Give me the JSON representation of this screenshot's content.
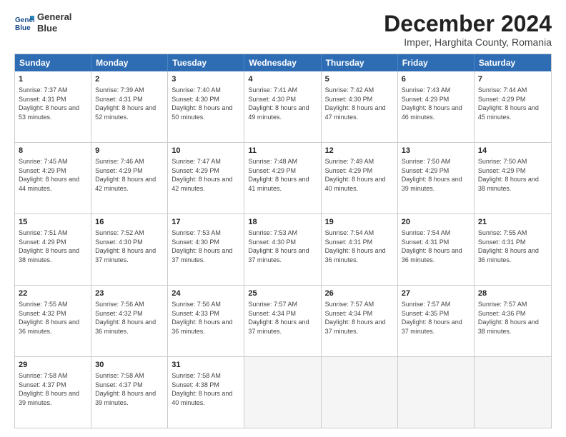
{
  "header": {
    "logo_line1": "General",
    "logo_line2": "Blue",
    "title": "December 2024",
    "subtitle": "Imper, Harghita County, Romania"
  },
  "days": [
    "Sunday",
    "Monday",
    "Tuesday",
    "Wednesday",
    "Thursday",
    "Friday",
    "Saturday"
  ],
  "weeks": [
    [
      {
        "day": "1",
        "sunrise": "Sunrise: 7:37 AM",
        "sunset": "Sunset: 4:31 PM",
        "daylight": "Daylight: 8 hours and 53 minutes."
      },
      {
        "day": "2",
        "sunrise": "Sunrise: 7:39 AM",
        "sunset": "Sunset: 4:31 PM",
        "daylight": "Daylight: 8 hours and 52 minutes."
      },
      {
        "day": "3",
        "sunrise": "Sunrise: 7:40 AM",
        "sunset": "Sunset: 4:30 PM",
        "daylight": "Daylight: 8 hours and 50 minutes."
      },
      {
        "day": "4",
        "sunrise": "Sunrise: 7:41 AM",
        "sunset": "Sunset: 4:30 PM",
        "daylight": "Daylight: 8 hours and 49 minutes."
      },
      {
        "day": "5",
        "sunrise": "Sunrise: 7:42 AM",
        "sunset": "Sunset: 4:30 PM",
        "daylight": "Daylight: 8 hours and 47 minutes."
      },
      {
        "day": "6",
        "sunrise": "Sunrise: 7:43 AM",
        "sunset": "Sunset: 4:29 PM",
        "daylight": "Daylight: 8 hours and 46 minutes."
      },
      {
        "day": "7",
        "sunrise": "Sunrise: 7:44 AM",
        "sunset": "Sunset: 4:29 PM",
        "daylight": "Daylight: 8 hours and 45 minutes."
      }
    ],
    [
      {
        "day": "8",
        "sunrise": "Sunrise: 7:45 AM",
        "sunset": "Sunset: 4:29 PM",
        "daylight": "Daylight: 8 hours and 44 minutes."
      },
      {
        "day": "9",
        "sunrise": "Sunrise: 7:46 AM",
        "sunset": "Sunset: 4:29 PM",
        "daylight": "Daylight: 8 hours and 42 minutes."
      },
      {
        "day": "10",
        "sunrise": "Sunrise: 7:47 AM",
        "sunset": "Sunset: 4:29 PM",
        "daylight": "Daylight: 8 hours and 42 minutes."
      },
      {
        "day": "11",
        "sunrise": "Sunrise: 7:48 AM",
        "sunset": "Sunset: 4:29 PM",
        "daylight": "Daylight: 8 hours and 41 minutes."
      },
      {
        "day": "12",
        "sunrise": "Sunrise: 7:49 AM",
        "sunset": "Sunset: 4:29 PM",
        "daylight": "Daylight: 8 hours and 40 minutes."
      },
      {
        "day": "13",
        "sunrise": "Sunrise: 7:50 AM",
        "sunset": "Sunset: 4:29 PM",
        "daylight": "Daylight: 8 hours and 39 minutes."
      },
      {
        "day": "14",
        "sunrise": "Sunrise: 7:50 AM",
        "sunset": "Sunset: 4:29 PM",
        "daylight": "Daylight: 8 hours and 38 minutes."
      }
    ],
    [
      {
        "day": "15",
        "sunrise": "Sunrise: 7:51 AM",
        "sunset": "Sunset: 4:29 PM",
        "daylight": "Daylight: 8 hours and 38 minutes."
      },
      {
        "day": "16",
        "sunrise": "Sunrise: 7:52 AM",
        "sunset": "Sunset: 4:30 PM",
        "daylight": "Daylight: 8 hours and 37 minutes."
      },
      {
        "day": "17",
        "sunrise": "Sunrise: 7:53 AM",
        "sunset": "Sunset: 4:30 PM",
        "daylight": "Daylight: 8 hours and 37 minutes."
      },
      {
        "day": "18",
        "sunrise": "Sunrise: 7:53 AM",
        "sunset": "Sunset: 4:30 PM",
        "daylight": "Daylight: 8 hours and 37 minutes."
      },
      {
        "day": "19",
        "sunrise": "Sunrise: 7:54 AM",
        "sunset": "Sunset: 4:31 PM",
        "daylight": "Daylight: 8 hours and 36 minutes."
      },
      {
        "day": "20",
        "sunrise": "Sunrise: 7:54 AM",
        "sunset": "Sunset: 4:31 PM",
        "daylight": "Daylight: 8 hours and 36 minutes."
      },
      {
        "day": "21",
        "sunrise": "Sunrise: 7:55 AM",
        "sunset": "Sunset: 4:31 PM",
        "daylight": "Daylight: 8 hours and 36 minutes."
      }
    ],
    [
      {
        "day": "22",
        "sunrise": "Sunrise: 7:55 AM",
        "sunset": "Sunset: 4:32 PM",
        "daylight": "Daylight: 8 hours and 36 minutes."
      },
      {
        "day": "23",
        "sunrise": "Sunrise: 7:56 AM",
        "sunset": "Sunset: 4:32 PM",
        "daylight": "Daylight: 8 hours and 36 minutes."
      },
      {
        "day": "24",
        "sunrise": "Sunrise: 7:56 AM",
        "sunset": "Sunset: 4:33 PM",
        "daylight": "Daylight: 8 hours and 36 minutes."
      },
      {
        "day": "25",
        "sunrise": "Sunrise: 7:57 AM",
        "sunset": "Sunset: 4:34 PM",
        "daylight": "Daylight: 8 hours and 37 minutes."
      },
      {
        "day": "26",
        "sunrise": "Sunrise: 7:57 AM",
        "sunset": "Sunset: 4:34 PM",
        "daylight": "Daylight: 8 hours and 37 minutes."
      },
      {
        "day": "27",
        "sunrise": "Sunrise: 7:57 AM",
        "sunset": "Sunset: 4:35 PM",
        "daylight": "Daylight: 8 hours and 37 minutes."
      },
      {
        "day": "28",
        "sunrise": "Sunrise: 7:57 AM",
        "sunset": "Sunset: 4:36 PM",
        "daylight": "Daylight: 8 hours and 38 minutes."
      }
    ],
    [
      {
        "day": "29",
        "sunrise": "Sunrise: 7:58 AM",
        "sunset": "Sunset: 4:37 PM",
        "daylight": "Daylight: 8 hours and 39 minutes."
      },
      {
        "day": "30",
        "sunrise": "Sunrise: 7:58 AM",
        "sunset": "Sunset: 4:37 PM",
        "daylight": "Daylight: 8 hours and 39 minutes."
      },
      {
        "day": "31",
        "sunrise": "Sunrise: 7:58 AM",
        "sunset": "Sunset: 4:38 PM",
        "daylight": "Daylight: 8 hours and 40 minutes."
      },
      null,
      null,
      null,
      null
    ]
  ]
}
